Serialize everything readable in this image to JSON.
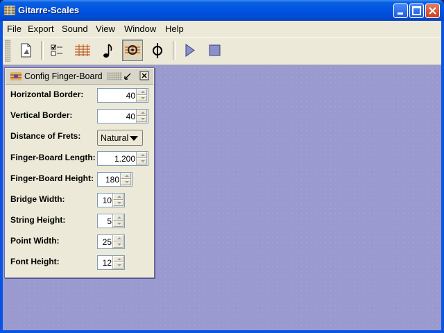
{
  "window": {
    "title": "Gitarre-Scales"
  },
  "menu": [
    "File",
    "Export",
    "Sound",
    "View",
    "Window",
    "Help"
  ],
  "toolbar": {
    "buttons": [
      {
        "icon": "document-icon"
      },
      {
        "icon": "checklist-icon"
      },
      {
        "icon": "fretboard-icon"
      },
      {
        "icon": "note-icon"
      },
      {
        "icon": "config-fretboard-icon",
        "pressed": true
      },
      {
        "icon": "tuning-fork-icon"
      },
      {
        "icon": "play-icon"
      },
      {
        "icon": "stop-icon"
      }
    ]
  },
  "config_frame": {
    "title": "Config Finger-Board",
    "fields": [
      {
        "label": "Horizontal Border:",
        "value": "40"
      },
      {
        "label": "Vertical Border:",
        "value": "40"
      },
      {
        "label": "Distance of Frets:",
        "value": "Natural"
      },
      {
        "label": "Finger-Board Length:",
        "value": "1.200"
      },
      {
        "label": "Finger-Board Height:",
        "value": "180"
      },
      {
        "label": "Bridge Width:",
        "value": "10"
      },
      {
        "label": "String Height:",
        "value": "5"
      },
      {
        "label": "Point Width:",
        "value": "25"
      },
      {
        "label": "Font Height:",
        "value": "12"
      }
    ]
  },
  "colors": {
    "titlebar": "#0053e0",
    "desktop": "#9a9ad0",
    "panel": "#ece9d8"
  }
}
